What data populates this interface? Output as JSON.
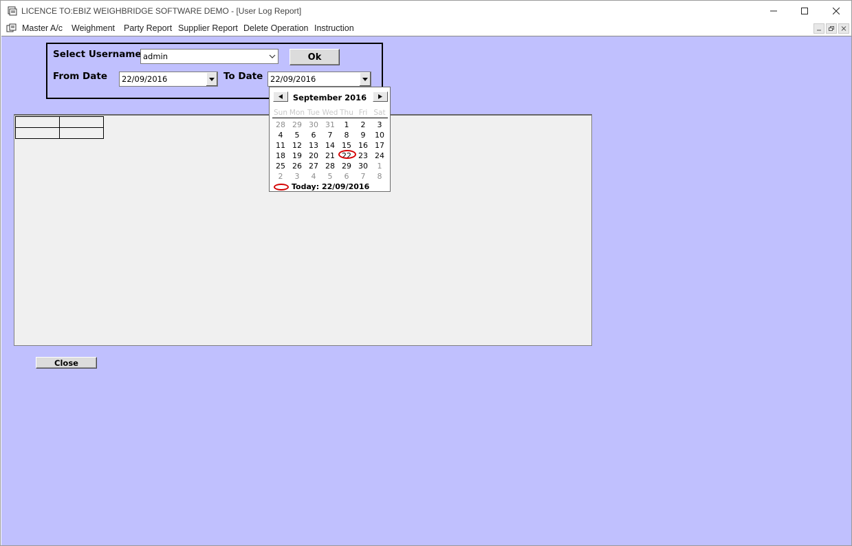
{
  "window": {
    "title": "LICENCE TO:EBIZ WEIGHBRIDGE SOFTWARE DEMO - [User Log Report]",
    "controls": {
      "minimize": "─",
      "maximize": "☐",
      "close": "✕"
    }
  },
  "menu": {
    "items": [
      "Master A/c",
      "Weighment",
      "Party Report",
      "Supplier Report",
      "Delete Operation",
      "Instruction"
    ]
  },
  "form": {
    "username_label": "Select Username",
    "username_value": "admin",
    "ok_label": "Ok",
    "from_label": "From Date",
    "from_value": "22/09/2016",
    "to_label": "To Date",
    "to_value": "22/09/2016",
    "close_label": "Close"
  },
  "calendar": {
    "month_label": "September 2016",
    "weekdays": [
      "Sun",
      "Mon",
      "Tue",
      "Wed",
      "Thu",
      "Fri",
      "Sat"
    ],
    "weeks": [
      [
        "28",
        "29",
        "30",
        "31",
        "1",
        "2",
        "3"
      ],
      [
        "4",
        "5",
        "6",
        "7",
        "8",
        "9",
        "10"
      ],
      [
        "11",
        "12",
        "13",
        "14",
        "15",
        "16",
        "17"
      ],
      [
        "18",
        "19",
        "20",
        "21",
        "22",
        "23",
        "24"
      ],
      [
        "25",
        "26",
        "27",
        "28",
        "29",
        "30",
        "1"
      ],
      [
        "2",
        "3",
        "4",
        "5",
        "6",
        "7",
        "8"
      ]
    ],
    "muted": [
      [
        0,
        0
      ],
      [
        0,
        1
      ],
      [
        0,
        2
      ],
      [
        0,
        3
      ],
      [
        4,
        6
      ],
      [
        5,
        0
      ],
      [
        5,
        1
      ],
      [
        5,
        2
      ],
      [
        5,
        3
      ],
      [
        5,
        4
      ],
      [
        5,
        5
      ],
      [
        5,
        6
      ]
    ],
    "selected": [
      3,
      4
    ],
    "today_label": "Today: 22/09/2016"
  },
  "colors": {
    "background": "#c0c0fe",
    "grid": "#f0f0f0",
    "highlight_ring": "#d40000"
  },
  "icons": {
    "app": "app-icon",
    "menu": "document-icon",
    "dropdown": "chevron-down-icon",
    "prev": "triangle-left-icon",
    "next": "triangle-right-icon"
  }
}
